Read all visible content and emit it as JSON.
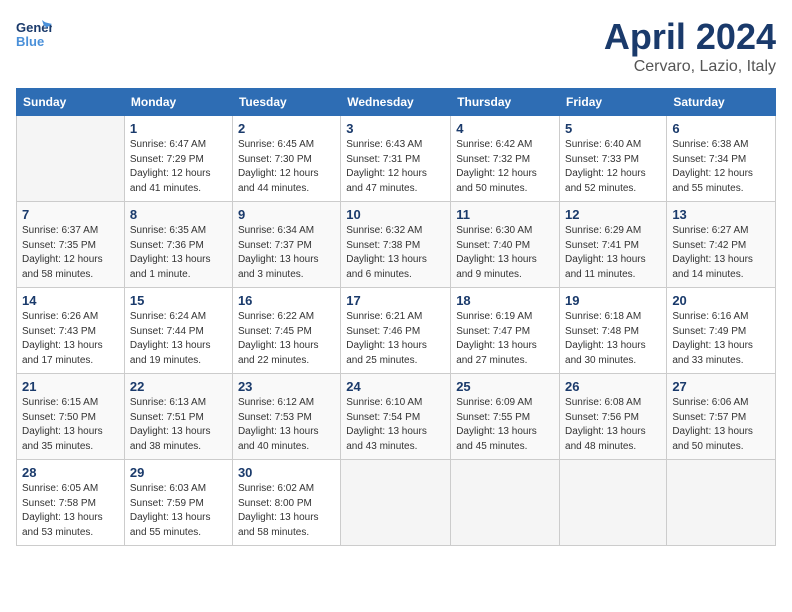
{
  "header": {
    "logo_line1": "General",
    "logo_line2": "Blue",
    "month": "April 2024",
    "location": "Cervaro, Lazio, Italy"
  },
  "days_of_week": [
    "Sunday",
    "Monday",
    "Tuesday",
    "Wednesday",
    "Thursday",
    "Friday",
    "Saturday"
  ],
  "weeks": [
    [
      {
        "day": "",
        "info": ""
      },
      {
        "day": "1",
        "info": "Sunrise: 6:47 AM\nSunset: 7:29 PM\nDaylight: 12 hours\nand 41 minutes."
      },
      {
        "day": "2",
        "info": "Sunrise: 6:45 AM\nSunset: 7:30 PM\nDaylight: 12 hours\nand 44 minutes."
      },
      {
        "day": "3",
        "info": "Sunrise: 6:43 AM\nSunset: 7:31 PM\nDaylight: 12 hours\nand 47 minutes."
      },
      {
        "day": "4",
        "info": "Sunrise: 6:42 AM\nSunset: 7:32 PM\nDaylight: 12 hours\nand 50 minutes."
      },
      {
        "day": "5",
        "info": "Sunrise: 6:40 AM\nSunset: 7:33 PM\nDaylight: 12 hours\nand 52 minutes."
      },
      {
        "day": "6",
        "info": "Sunrise: 6:38 AM\nSunset: 7:34 PM\nDaylight: 12 hours\nand 55 minutes."
      }
    ],
    [
      {
        "day": "7",
        "info": "Sunrise: 6:37 AM\nSunset: 7:35 PM\nDaylight: 12 hours\nand 58 minutes."
      },
      {
        "day": "8",
        "info": "Sunrise: 6:35 AM\nSunset: 7:36 PM\nDaylight: 13 hours\nand 1 minute."
      },
      {
        "day": "9",
        "info": "Sunrise: 6:34 AM\nSunset: 7:37 PM\nDaylight: 13 hours\nand 3 minutes."
      },
      {
        "day": "10",
        "info": "Sunrise: 6:32 AM\nSunset: 7:38 PM\nDaylight: 13 hours\nand 6 minutes."
      },
      {
        "day": "11",
        "info": "Sunrise: 6:30 AM\nSunset: 7:40 PM\nDaylight: 13 hours\nand 9 minutes."
      },
      {
        "day": "12",
        "info": "Sunrise: 6:29 AM\nSunset: 7:41 PM\nDaylight: 13 hours\nand 11 minutes."
      },
      {
        "day": "13",
        "info": "Sunrise: 6:27 AM\nSunset: 7:42 PM\nDaylight: 13 hours\nand 14 minutes."
      }
    ],
    [
      {
        "day": "14",
        "info": "Sunrise: 6:26 AM\nSunset: 7:43 PM\nDaylight: 13 hours\nand 17 minutes."
      },
      {
        "day": "15",
        "info": "Sunrise: 6:24 AM\nSunset: 7:44 PM\nDaylight: 13 hours\nand 19 minutes."
      },
      {
        "day": "16",
        "info": "Sunrise: 6:22 AM\nSunset: 7:45 PM\nDaylight: 13 hours\nand 22 minutes."
      },
      {
        "day": "17",
        "info": "Sunrise: 6:21 AM\nSunset: 7:46 PM\nDaylight: 13 hours\nand 25 minutes."
      },
      {
        "day": "18",
        "info": "Sunrise: 6:19 AM\nSunset: 7:47 PM\nDaylight: 13 hours\nand 27 minutes."
      },
      {
        "day": "19",
        "info": "Sunrise: 6:18 AM\nSunset: 7:48 PM\nDaylight: 13 hours\nand 30 minutes."
      },
      {
        "day": "20",
        "info": "Sunrise: 6:16 AM\nSunset: 7:49 PM\nDaylight: 13 hours\nand 33 minutes."
      }
    ],
    [
      {
        "day": "21",
        "info": "Sunrise: 6:15 AM\nSunset: 7:50 PM\nDaylight: 13 hours\nand 35 minutes."
      },
      {
        "day": "22",
        "info": "Sunrise: 6:13 AM\nSunset: 7:51 PM\nDaylight: 13 hours\nand 38 minutes."
      },
      {
        "day": "23",
        "info": "Sunrise: 6:12 AM\nSunset: 7:53 PM\nDaylight: 13 hours\nand 40 minutes."
      },
      {
        "day": "24",
        "info": "Sunrise: 6:10 AM\nSunset: 7:54 PM\nDaylight: 13 hours\nand 43 minutes."
      },
      {
        "day": "25",
        "info": "Sunrise: 6:09 AM\nSunset: 7:55 PM\nDaylight: 13 hours\nand 45 minutes."
      },
      {
        "day": "26",
        "info": "Sunrise: 6:08 AM\nSunset: 7:56 PM\nDaylight: 13 hours\nand 48 minutes."
      },
      {
        "day": "27",
        "info": "Sunrise: 6:06 AM\nSunset: 7:57 PM\nDaylight: 13 hours\nand 50 minutes."
      }
    ],
    [
      {
        "day": "28",
        "info": "Sunrise: 6:05 AM\nSunset: 7:58 PM\nDaylight: 13 hours\nand 53 minutes."
      },
      {
        "day": "29",
        "info": "Sunrise: 6:03 AM\nSunset: 7:59 PM\nDaylight: 13 hours\nand 55 minutes."
      },
      {
        "day": "30",
        "info": "Sunrise: 6:02 AM\nSunset: 8:00 PM\nDaylight: 13 hours\nand 58 minutes."
      },
      {
        "day": "",
        "info": ""
      },
      {
        "day": "",
        "info": ""
      },
      {
        "day": "",
        "info": ""
      },
      {
        "day": "",
        "info": ""
      }
    ]
  ]
}
